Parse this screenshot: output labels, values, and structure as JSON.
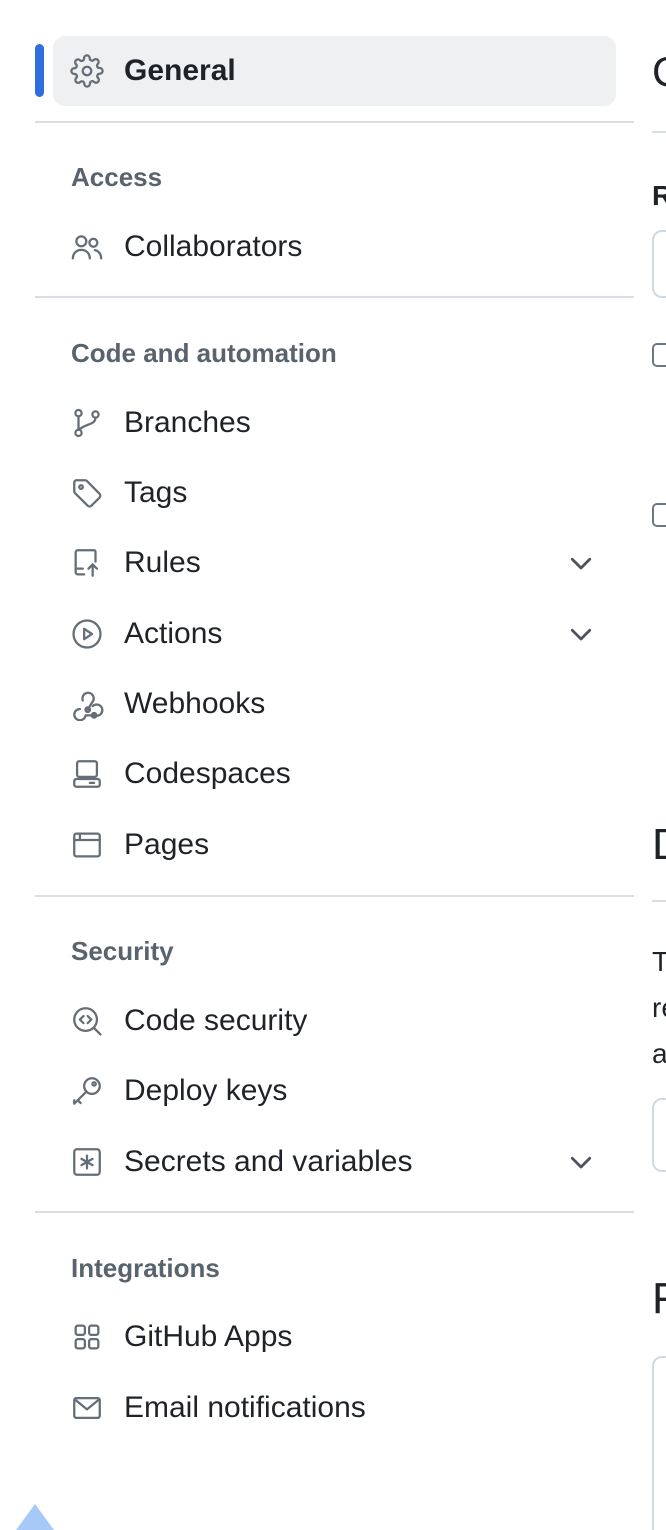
{
  "nav": {
    "general": "General",
    "sections": {
      "access": {
        "title": "Access",
        "items": {
          "collaborators": "Collaborators"
        }
      },
      "code": {
        "title": "Code and automation",
        "items": {
          "branches": "Branches",
          "tags": "Tags",
          "rules": "Rules",
          "actions": "Actions",
          "webhooks": "Webhooks",
          "codespaces": "Codespaces",
          "pages": "Pages"
        }
      },
      "security": {
        "title": "Security",
        "items": {
          "code_security": "Code security",
          "deploy_keys": "Deploy keys",
          "secrets": "Secrets and variables"
        }
      },
      "integrations": {
        "title": "Integrations",
        "items": {
          "github_apps": "GitHub Apps",
          "email": "Email notifications"
        }
      }
    }
  },
  "right": {
    "heading_1": "G",
    "label_1": "R",
    "heading_2": "D",
    "para_line_1": "T",
    "para_line_2": "re",
    "para_line_3": "a",
    "heading_3": "F"
  },
  "colors": {
    "accent": "#2f6de1",
    "active_bg": "#eef0f2",
    "section_title": "#59636e",
    "icon": "#656d76"
  }
}
